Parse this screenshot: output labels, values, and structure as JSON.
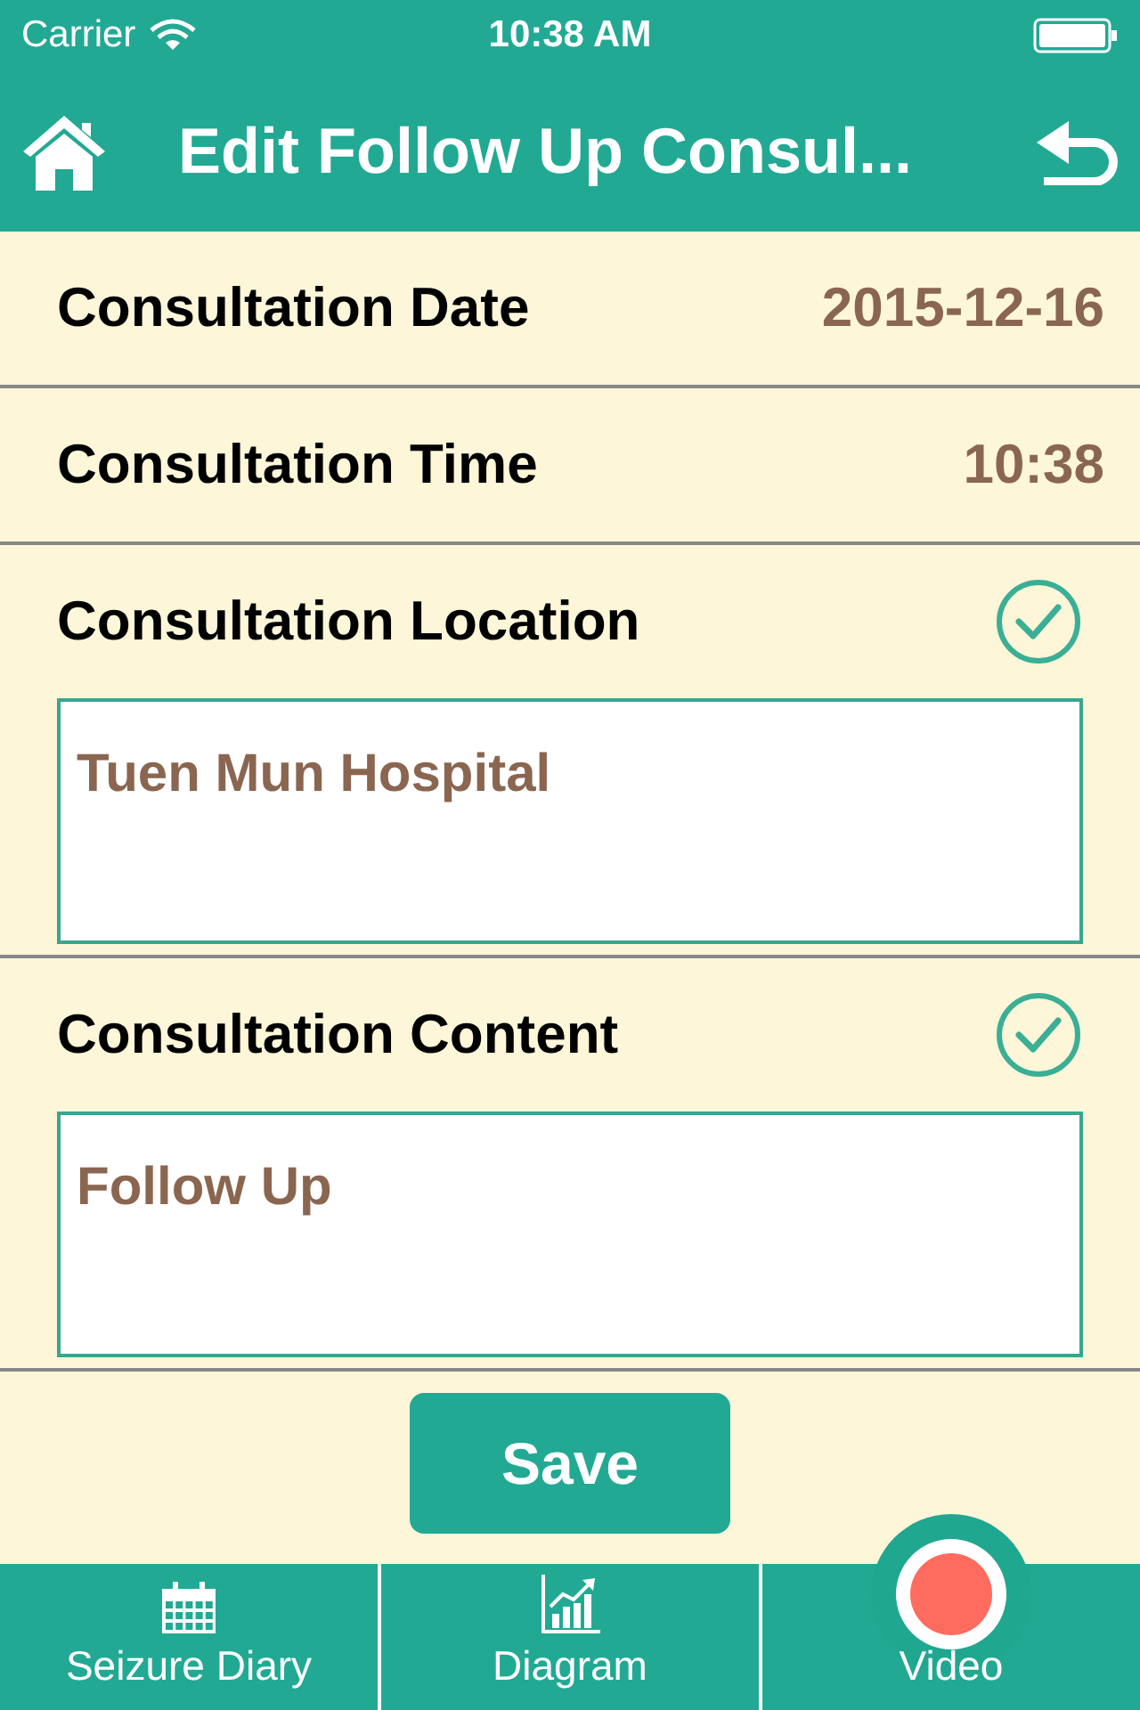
{
  "status_bar": {
    "carrier": "Carrier",
    "time": "10:38 AM"
  },
  "nav": {
    "title": "Edit Follow Up Consul..."
  },
  "fields": [
    {
      "kind": "value",
      "label": "Consultation Date",
      "value": "2015-12-16"
    },
    {
      "kind": "value",
      "label": "Consultation Time",
      "value": "10:38"
    },
    {
      "kind": "text",
      "label": "Consultation Location",
      "value": "Tuen Mun Hospital"
    },
    {
      "kind": "text",
      "label": "Consultation Content",
      "value": "Follow Up"
    }
  ],
  "save_button": "Save",
  "tab_bar": [
    {
      "kind": "calendar",
      "label": "Seizure Diary"
    },
    {
      "kind": "chart",
      "label": "Diagram"
    },
    {
      "kind": "record",
      "label": "Video"
    }
  ]
}
